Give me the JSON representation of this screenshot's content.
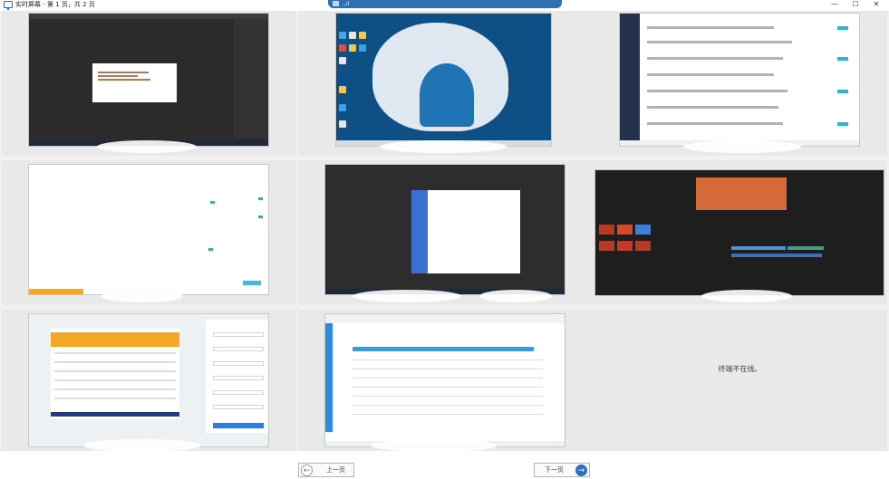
{
  "window": {
    "title": "实时屏幕 - 第 1 页，共 2 页",
    "minimize": "—",
    "maximize": "☐",
    "close": "✕"
  },
  "top_tab": {
    "signal": "..ıl"
  },
  "grid": {
    "offline_text": "终端不在线。"
  },
  "pagination": {
    "prev_label": "上一页",
    "next_label": "下一页",
    "prev_arrow": "←",
    "next_arrow": "→"
  }
}
